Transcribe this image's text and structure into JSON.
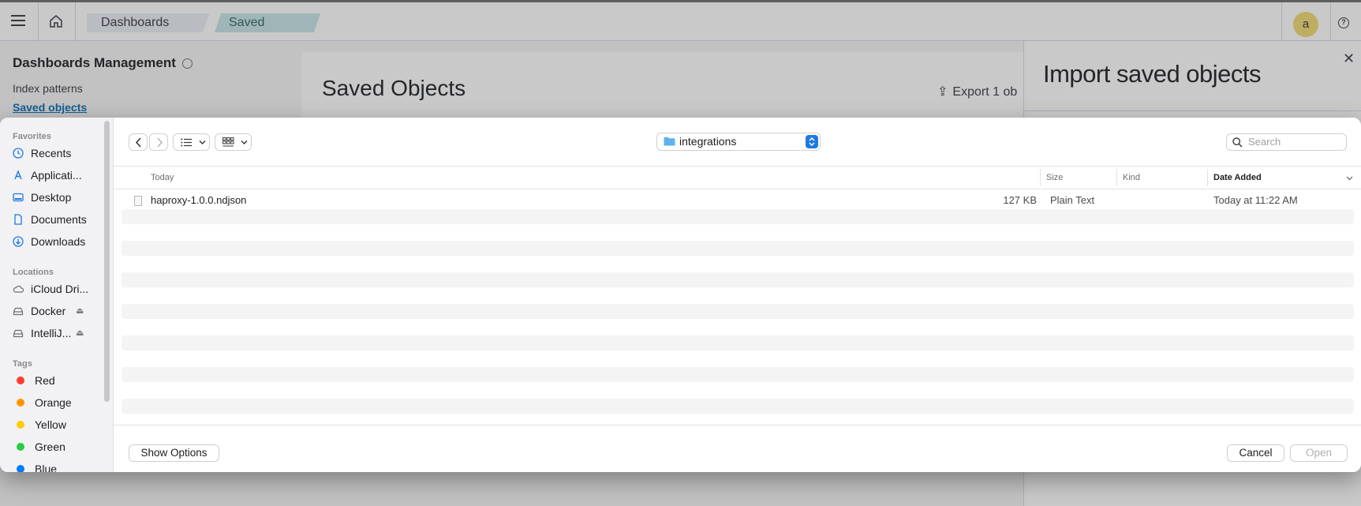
{
  "header": {
    "breadcrumbs": [
      "Dashboards Ma...",
      "Saved objects"
    ],
    "avatar_letter": "a"
  },
  "background_page": {
    "sidebar_title": "Dashboards Management",
    "nav": [
      "Index patterns",
      "Saved objects"
    ],
    "main_title": "Saved Objects",
    "export_label": "Export 1 ob"
  },
  "flyout": {
    "title": "Import saved objects"
  },
  "dialog": {
    "sidebar": {
      "sections": [
        {
          "heading": "Favorites",
          "items": [
            "Recents",
            "Applicati...",
            "Desktop",
            "Documents",
            "Downloads"
          ]
        },
        {
          "heading": "Locations",
          "items": [
            "iCloud Dri...",
            "Docker",
            "IntelliJ..."
          ]
        },
        {
          "heading": "Tags",
          "items": [
            "Red",
            "Orange",
            "Yellow",
            "Green",
            "Blue"
          ]
        }
      ],
      "tag_colors": [
        "#ff3b30",
        "#ff9500",
        "#ffcc00",
        "#28cd41",
        "#007aff"
      ]
    },
    "location": "integrations",
    "search_placeholder": "Search",
    "columns": [
      "Today",
      "Size",
      "Kind",
      "Date Added"
    ],
    "files": [
      {
        "name": "haproxy-1.0.0.ndjson",
        "size": "127 KB",
        "kind": "Plain Text",
        "date_added": "Today at 11:22 AM"
      }
    ],
    "buttons": {
      "show_options": "Show Options",
      "cancel": "Cancel",
      "open": "Open"
    }
  }
}
